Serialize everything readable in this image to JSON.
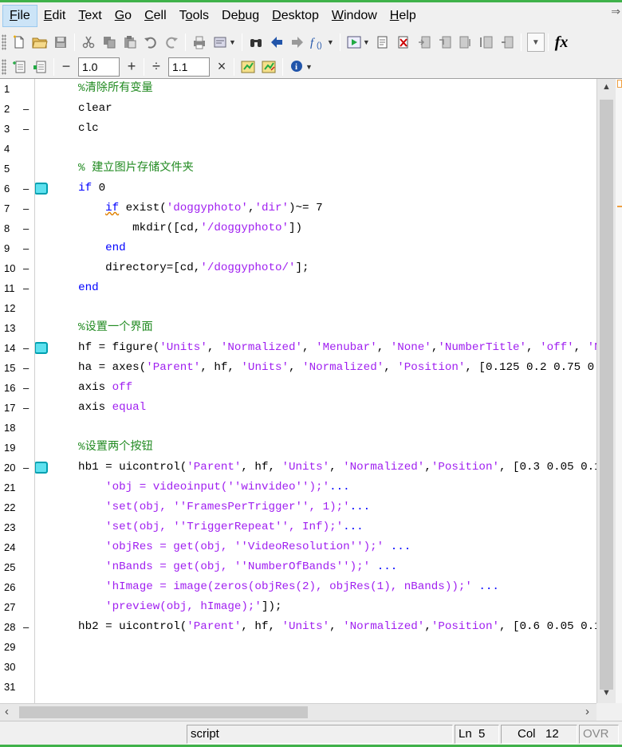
{
  "menu": [
    {
      "label": "File",
      "key": "F",
      "rest": "ile"
    },
    {
      "label": "Edit",
      "key": "E",
      "rest": "dit"
    },
    {
      "label": "Text",
      "key": "T",
      "rest": "ext"
    },
    {
      "label": "Go",
      "key": "G",
      "rest": "o"
    },
    {
      "label": "Cell",
      "key": "C",
      "rest": "ell"
    },
    {
      "label": "Tools",
      "pre": "T",
      "key": "o",
      "rest": "ols"
    },
    {
      "label": "Debug",
      "pre": "De",
      "key": "b",
      "rest": "ug"
    },
    {
      "label": "Desktop",
      "key": "D",
      "rest": "esktop"
    },
    {
      "label": "Window",
      "key": "W",
      "rest": "indow"
    },
    {
      "label": "Help",
      "key": "H",
      "rest": "elp"
    }
  ],
  "toolbar": {
    "fx_label": "fx",
    "cell_decrement": "−",
    "cell_increment": "+",
    "cell_value_1": "1.0",
    "cell_divide": "÷",
    "cell_value_2": "1.1",
    "cell_multiply": "×"
  },
  "editor": {
    "lines": [
      {
        "n": "1",
        "exec": false,
        "cell": false,
        "segs": [
          [
            "cmt",
            "    %清除所有变量"
          ]
        ]
      },
      {
        "n": "2",
        "exec": true,
        "cell": false,
        "segs": [
          [
            "txt",
            "    clear"
          ]
        ]
      },
      {
        "n": "3",
        "exec": true,
        "cell": false,
        "segs": [
          [
            "txt",
            "    clc"
          ]
        ]
      },
      {
        "n": "4",
        "exec": false,
        "cell": false,
        "segs": []
      },
      {
        "n": "5",
        "exec": false,
        "cell": false,
        "segs": [
          [
            "cmt",
            "    % 建立图片存储文件夹"
          ]
        ]
      },
      {
        "n": "6",
        "exec": true,
        "cell": true,
        "segs": [
          [
            "txt",
            "    "
          ],
          [
            "kw",
            "if"
          ],
          [
            "txt",
            " 0"
          ]
        ]
      },
      {
        "n": "7",
        "exec": true,
        "cell": false,
        "segs": [
          [
            "txt",
            "        "
          ],
          [
            "kwwavy",
            "if"
          ],
          [
            "txt",
            " exist("
          ],
          [
            "str",
            "'doggyphoto'"
          ],
          [
            "txt",
            ","
          ],
          [
            "str",
            "'dir'"
          ],
          [
            "txt",
            ")~= 7"
          ]
        ]
      },
      {
        "n": "8",
        "exec": true,
        "cell": false,
        "segs": [
          [
            "txt",
            "            mkdir([cd,"
          ],
          [
            "str",
            "'/doggyphoto'"
          ],
          [
            "txt",
            "])"
          ]
        ]
      },
      {
        "n": "9",
        "exec": true,
        "cell": false,
        "segs": [
          [
            "txt",
            "        "
          ],
          [
            "kw",
            "end"
          ]
        ]
      },
      {
        "n": "10",
        "exec": true,
        "cell": false,
        "segs": [
          [
            "txt",
            "        directory=[cd,"
          ],
          [
            "str",
            "'/doggyphoto/'"
          ],
          [
            "txt",
            "];"
          ]
        ]
      },
      {
        "n": "11",
        "exec": true,
        "cell": false,
        "segs": [
          [
            "txt",
            "    "
          ],
          [
            "kw",
            "end"
          ]
        ]
      },
      {
        "n": "12",
        "exec": false,
        "cell": false,
        "segs": []
      },
      {
        "n": "13",
        "exec": false,
        "cell": false,
        "segs": [
          [
            "cmt",
            "    %设置一个界面"
          ]
        ]
      },
      {
        "n": "14",
        "exec": true,
        "cell": true,
        "segs": [
          [
            "txt",
            "    hf = figure("
          ],
          [
            "str",
            "'Units'"
          ],
          [
            "txt",
            ", "
          ],
          [
            "str",
            "'Normalized'"
          ],
          [
            "txt",
            ", "
          ],
          [
            "str",
            "'Menubar'"
          ],
          [
            "txt",
            ", "
          ],
          [
            "str",
            "'None'"
          ],
          [
            "txt",
            ","
          ],
          [
            "str",
            "'NumberTitle'"
          ],
          [
            "txt",
            ", "
          ],
          [
            "str",
            "'off'"
          ],
          [
            "txt",
            ", "
          ],
          [
            "str",
            "'N"
          ]
        ]
      },
      {
        "n": "15",
        "exec": true,
        "cell": false,
        "segs": [
          [
            "txt",
            "    ha = axes("
          ],
          [
            "str",
            "'Parent'"
          ],
          [
            "txt",
            ", hf, "
          ],
          [
            "str",
            "'Units'"
          ],
          [
            "txt",
            ", "
          ],
          [
            "str",
            "'Normalized'"
          ],
          [
            "txt",
            ", "
          ],
          [
            "str",
            "'Position'"
          ],
          [
            "txt",
            ", [0.125 0.2 0.75 0."
          ]
        ]
      },
      {
        "n": "16",
        "exec": true,
        "cell": false,
        "segs": [
          [
            "txt",
            "    axis "
          ],
          [
            "str",
            "off"
          ]
        ]
      },
      {
        "n": "17",
        "exec": true,
        "cell": false,
        "segs": [
          [
            "txt",
            "    axis "
          ],
          [
            "str",
            "equal"
          ]
        ]
      },
      {
        "n": "18",
        "exec": false,
        "cell": false,
        "segs": []
      },
      {
        "n": "19",
        "exec": false,
        "cell": false,
        "segs": [
          [
            "cmt",
            "    %设置两个按钮"
          ]
        ]
      },
      {
        "n": "20",
        "exec": true,
        "cell": true,
        "segs": [
          [
            "txt",
            "    hb1 = uicontrol("
          ],
          [
            "str",
            "'Parent'"
          ],
          [
            "txt",
            ", hf, "
          ],
          [
            "str",
            "'Units'"
          ],
          [
            "txt",
            ", "
          ],
          [
            "str",
            "'Normalized'"
          ],
          [
            "txt",
            ","
          ],
          [
            "str",
            "'Position'"
          ],
          [
            "txt",
            ", [0.3 0.05 0.1"
          ]
        ]
      },
      {
        "n": "21",
        "exec": false,
        "cell": false,
        "segs": [
          [
            "txt",
            "        "
          ],
          [
            "str",
            "'obj = videoinput(''winvideo'');'"
          ],
          [
            "kw",
            "..."
          ]
        ]
      },
      {
        "n": "22",
        "exec": false,
        "cell": false,
        "segs": [
          [
            "txt",
            "        "
          ],
          [
            "str",
            "'set(obj, ''FramesPerTrigger'', 1);'"
          ],
          [
            "kw",
            "..."
          ]
        ]
      },
      {
        "n": "23",
        "exec": false,
        "cell": false,
        "segs": [
          [
            "txt",
            "        "
          ],
          [
            "str",
            "'set(obj, ''TriggerRepeat'', Inf);'"
          ],
          [
            "kw",
            "..."
          ]
        ]
      },
      {
        "n": "24",
        "exec": false,
        "cell": false,
        "segs": [
          [
            "txt",
            "        "
          ],
          [
            "str",
            "'objRes = get(obj, ''VideoResolution'');'"
          ],
          [
            "txt",
            " "
          ],
          [
            "kw",
            "..."
          ]
        ]
      },
      {
        "n": "25",
        "exec": false,
        "cell": false,
        "segs": [
          [
            "txt",
            "        "
          ],
          [
            "str",
            "'nBands = get(obj, ''NumberOfBands'');'"
          ],
          [
            "txt",
            " "
          ],
          [
            "kw",
            "..."
          ]
        ]
      },
      {
        "n": "26",
        "exec": false,
        "cell": false,
        "segs": [
          [
            "txt",
            "        "
          ],
          [
            "str",
            "'hImage = image(zeros(objRes(2), objRes(1), nBands));'"
          ],
          [
            "txt",
            " "
          ],
          [
            "kw",
            "..."
          ]
        ]
      },
      {
        "n": "27",
        "exec": false,
        "cell": false,
        "segs": [
          [
            "txt",
            "        "
          ],
          [
            "str",
            "'preview(obj, hImage);'"
          ],
          [
            "txt",
            "]);"
          ]
        ]
      },
      {
        "n": "28",
        "exec": true,
        "cell": false,
        "segs": [
          [
            "txt",
            "    hb2 = uicontrol("
          ],
          [
            "str",
            "'Parent'"
          ],
          [
            "txt",
            ", hf, "
          ],
          [
            "str",
            "'Units'"
          ],
          [
            "txt",
            ", "
          ],
          [
            "str",
            "'Normalized'"
          ],
          [
            "txt",
            ","
          ],
          [
            "str",
            "'Position'"
          ],
          [
            "txt",
            ", [0.6 0.05 0.1"
          ]
        ]
      },
      {
        "n": "29",
        "exec": false,
        "cell": false,
        "segs": []
      },
      {
        "n": "30",
        "exec": false,
        "cell": false,
        "segs": []
      },
      {
        "n": "31",
        "exec": false,
        "cell": false,
        "segs": []
      }
    ]
  },
  "status": {
    "mode": "script",
    "ln_label": "Ln",
    "ln_value": "5",
    "col_label": "Col",
    "col_value": "12",
    "ovr": "OVR"
  },
  "colors": {
    "comment": "#228b22",
    "keyword": "#0000ff",
    "string": "#a020f0",
    "cell_marker": "#5ee1ef",
    "window_border": "#3fb24a"
  }
}
